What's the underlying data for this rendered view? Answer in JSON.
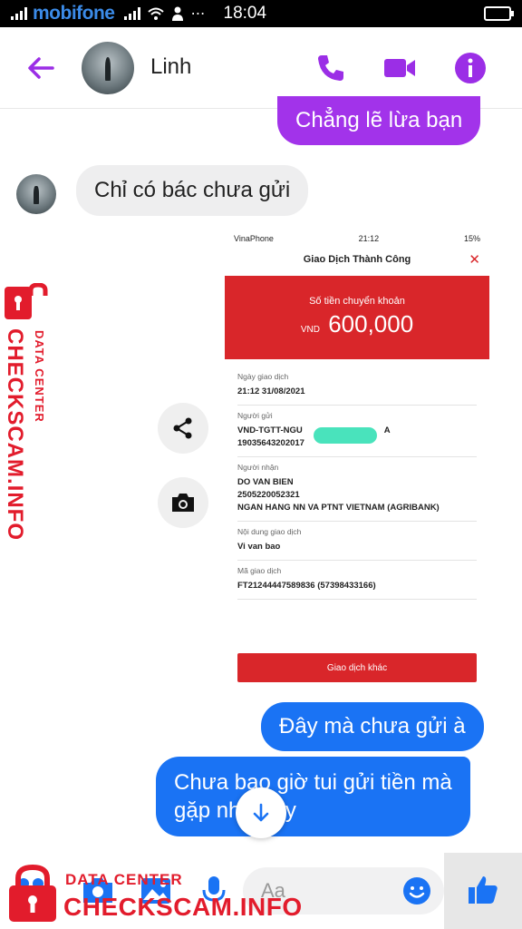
{
  "status_bar": {
    "carrier": "mobifone",
    "time": "18:04"
  },
  "header": {
    "contact_name": "Linh"
  },
  "messages": [
    {
      "from": "me",
      "text": "Chẳng lẽ lừa bạn"
    },
    {
      "from": "them",
      "text": "Chỉ có bác chưa gửi"
    },
    {
      "from": "me",
      "text": "Đây mà chưa gửi à"
    },
    {
      "from": "me",
      "text_line1": "Chưa bao giờ tui gửi tiền mà",
      "text_line2": "gặp như này"
    }
  ],
  "receipt": {
    "status_carrier": "VinaPhone",
    "status_time": "21:12",
    "status_battery": "15%",
    "title": "Giao Dịch Thành Công",
    "amount_label": "Số tiền chuyển khoản",
    "currency": "VND",
    "amount": "600,000",
    "date_label": "Ngày giao dịch",
    "date_value": "21:12 31/08/2021",
    "sender_label": "Người gửi",
    "sender_line1": "VND-TGTT-NGU",
    "sender_line1_end": "A",
    "sender_line2": "19035643202017",
    "receiver_label": "Người nhận",
    "receiver_name": "DO VAN BIEN",
    "receiver_account": "2505220052321",
    "receiver_bank": "NGAN HANG NN VA PTNT VIETNAM (AGRIBANK)",
    "content_label": "Nội dung giao dịch",
    "content_value": "Vi van bao",
    "code_label": "Mã giao dịch",
    "code_value": "FT21244447589836 (57398433166)",
    "button": "Giao dịch khác"
  },
  "composer": {
    "placeholder": "Aa"
  },
  "watermark": {
    "line1": "DATA CENTER",
    "line2": "CHECKSCAM.INFO"
  },
  "colors": {
    "messenger_purple": "#a233ea",
    "messenger_blue": "#1a73f4",
    "bank_red": "#d9262a",
    "watermark_red": "#e21c2c"
  }
}
